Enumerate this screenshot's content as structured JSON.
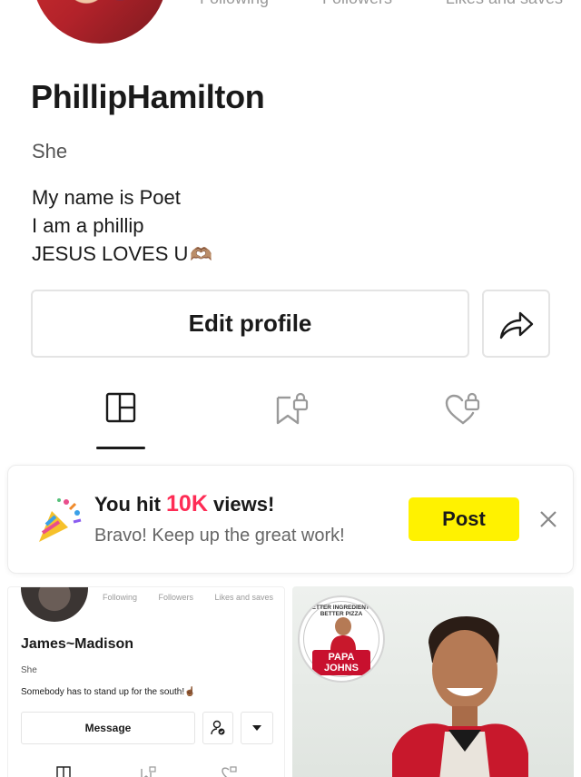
{
  "profile": {
    "username": "PhillipHamilton",
    "pronoun": "She",
    "bio_lines": [
      "My name is Poet",
      "I am a phillip",
      "JESUS LOVES U"
    ],
    "bio_emoji": "🫶🏽",
    "stats": {
      "following_label": "Following",
      "followers_label": "Followers",
      "likes_label": "Likes and saves"
    },
    "edit_label": "Edit profile"
  },
  "milestone": {
    "title_prefix": "You hit ",
    "title_highlight": "10K",
    "title_suffix": " views!",
    "subtitle": "Bravo! Keep up the great work!",
    "post_label": "Post",
    "highlight_color": "#fe2c55",
    "button_color": "#fff200"
  },
  "grid": {
    "left": {
      "stats": {
        "following_label": "Following",
        "followers_label": "Followers",
        "likes_label": "Likes and saves"
      },
      "username": "James~Madison",
      "pronoun": "She",
      "bio": "Somebody has to stand up for the south!☝🏾",
      "message_label": "Message"
    },
    "right": {
      "badge_arc": "BETTER INGREDIENTS. BETTER PIZZA",
      "badge_brand": "PAPA JOHNS"
    }
  },
  "icons": {
    "share": "share-icon",
    "grid_tab": "grid-icon",
    "saved_tab": "bookmark-lock-icon",
    "liked_tab": "heart-lock-icon",
    "close": "close-icon",
    "party": "party-popper-icon"
  }
}
